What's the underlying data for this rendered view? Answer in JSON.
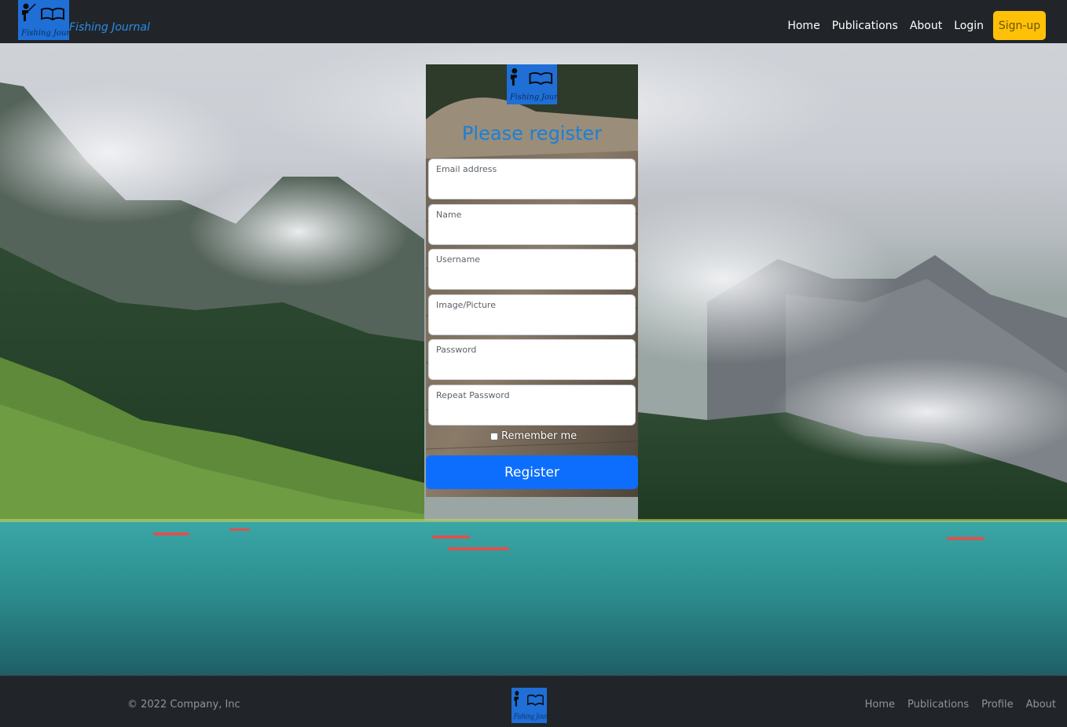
{
  "navbar": {
    "brand_text": "Fishing Journal",
    "links": [
      "Home",
      "Publications",
      "About",
      "Login"
    ],
    "signup_label": "Sign-up"
  },
  "form": {
    "title": "Please register",
    "fields": [
      {
        "label": "Email address",
        "value": ""
      },
      {
        "label": "Name",
        "value": ""
      },
      {
        "label": "Username",
        "value": ""
      },
      {
        "label": "Image/Picture",
        "value": ""
      },
      {
        "label": "Password",
        "value": ""
      },
      {
        "label": "Repeat Password",
        "value": ""
      }
    ],
    "remember_label": "Remember me",
    "remember_checked": false,
    "submit_label": "Register"
  },
  "footer": {
    "copyright": "© 2022 Company, Inc",
    "links": [
      "Home",
      "Publications",
      "Profile",
      "About"
    ]
  },
  "colors": {
    "navbar_bg": "#212529",
    "signup_bg": "#ffc107",
    "primary": "#0d6efd",
    "title": "#1a7fd8",
    "logo_bg": "#1f6fd6"
  },
  "icons": [
    "fishing-journal-logo-icon"
  ]
}
